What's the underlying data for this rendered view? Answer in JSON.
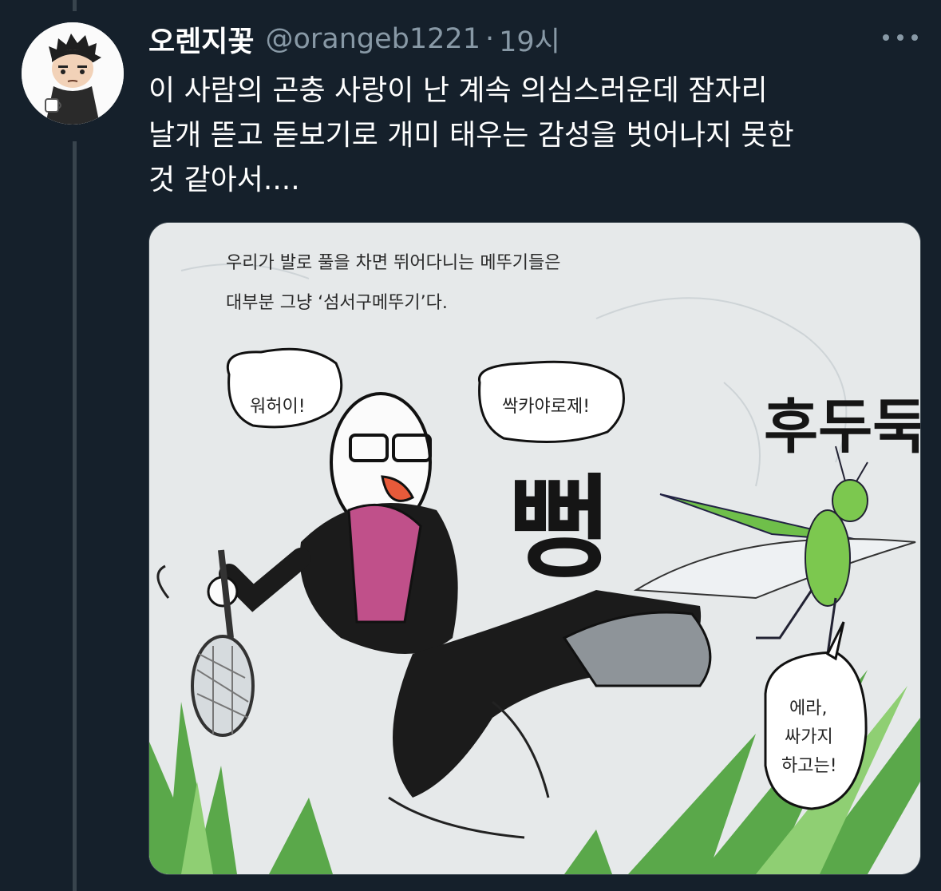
{
  "tweet": {
    "display_name": "오렌지꽃",
    "handle": "@orangeb1221",
    "separator": "·",
    "time": "19시",
    "text": "이 사람의 곤충 사랑이 난 계속 의심스러운데 잠자리\n날개 뜯고 돋보기로 개미 태우는 감성을 벗어나지 못한\n것 같아서....",
    "more_icon": "more-horizontal-icon"
  },
  "comic": {
    "caption_line1": "우리가 발로 풀을 차면 뛰어다니는 메뚜기들은",
    "caption_line2": "대부분 그냥 ‘섬서구메뚜기’다.",
    "bubble_left": "워허이!",
    "bubble_center": "싹카야로제!",
    "bubble_right_line1": "에라,",
    "bubble_right_line2": "싸가지",
    "bubble_right_line3": "하고는!",
    "sfx_kick": "뻥",
    "sfx_hop": "후두둑"
  },
  "colors": {
    "background": "#15202b",
    "text_primary": "#ffffff",
    "text_secondary": "#8899a6",
    "thread_line": "#38444d"
  }
}
